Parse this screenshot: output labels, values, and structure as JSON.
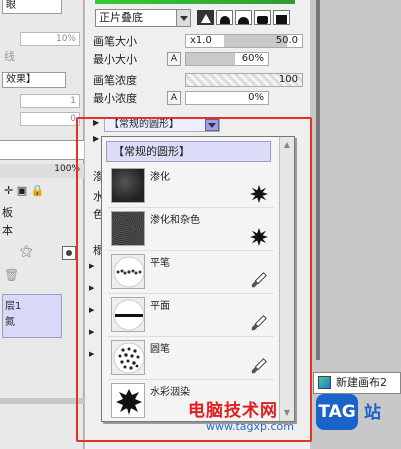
{
  "left_panel": {
    "top_select": "眼",
    "label1": "线",
    "pct1": "10%",
    "effect_select": "效果】",
    "num1": "1",
    "num2": "0",
    "pct_label": "100%",
    "text1": "板",
    "text2": "本",
    "layer_label": "层1",
    "layer_sub": "氮"
  },
  "brush_settings": {
    "blend_mode": "正片叠底",
    "size_label": "画笔大小",
    "size_mult": "x1.0",
    "size_value": "50.0",
    "min_size_label": "最小大小",
    "min_size_value": "60%",
    "min_size_fraction": 0.6,
    "density_label": "画笔浓度",
    "density_value": "100",
    "min_density_label": "最小浓度",
    "min_density_value": "0%",
    "texture_select": "【常规的圆形】",
    "partial_labels": [
      "渗",
      "水",
      "色"
    ],
    "partial_label_2": "榻"
  },
  "texture_popup": {
    "header": "【常规的圆形】",
    "items": [
      {
        "name": "渗化",
        "thumb": "dark-noise",
        "icon": "spiky-star-icon"
      },
      {
        "name": "渗化和杂色",
        "thumb": "dark-grain",
        "icon": "spiky-star-icon"
      },
      {
        "name": "平笔",
        "thumb": "flat-brush-dots",
        "icon": "brush-icon"
      },
      {
        "name": "平面",
        "thumb": "flat-line",
        "icon": "brush-icon"
      },
      {
        "name": "圆笔",
        "thumb": "round-dots",
        "icon": "brush-icon"
      },
      {
        "name": "水彩洇染",
        "thumb": "watercolor-blot",
        "icon": ""
      }
    ]
  },
  "canvas_tab": {
    "label": "新建画布2"
  },
  "watermark": {
    "title": "电脑技术网",
    "url": "www.tagxp.com",
    "tag": "TAG",
    "suffix": "站"
  },
  "colors": {
    "highlight": "#e8302a",
    "accent": "#9aa0ee",
    "tag_blue": "#1a63c9"
  }
}
